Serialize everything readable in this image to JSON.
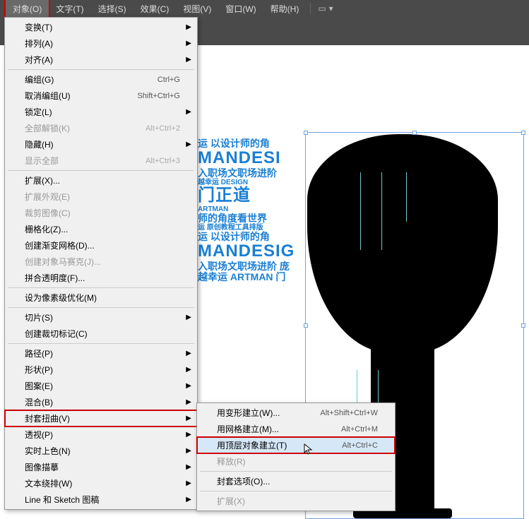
{
  "menubar": {
    "items": [
      "对象(O)",
      "文字(T)",
      "选择(S)",
      "效果(C)",
      "视图(V)",
      "窗口(W)",
      "帮助(H)"
    ]
  },
  "dropdown": [
    {
      "label": "变换(T)",
      "arrow": true
    },
    {
      "label": "排列(A)",
      "arrow": true
    },
    {
      "label": "对齐(A)",
      "arrow": true
    },
    {
      "sep": true
    },
    {
      "label": "编组(G)",
      "shortcut": "Ctrl+G"
    },
    {
      "label": "取消编组(U)",
      "shortcut": "Shift+Ctrl+G"
    },
    {
      "label": "锁定(L)",
      "arrow": true
    },
    {
      "label": "全部解锁(K)",
      "shortcut": "Alt+Ctrl+2",
      "disabled": true
    },
    {
      "label": "隐藏(H)",
      "arrow": true
    },
    {
      "label": "显示全部",
      "shortcut": "Alt+Ctrl+3",
      "disabled": true
    },
    {
      "sep": true
    },
    {
      "label": "扩展(X)..."
    },
    {
      "label": "扩展外观(E)",
      "disabled": true
    },
    {
      "label": "裁剪图像(C)",
      "disabled": true
    },
    {
      "label": "栅格化(Z)..."
    },
    {
      "label": "创建渐变网格(D)..."
    },
    {
      "label": "创建对象马赛克(J)...",
      "disabled": true
    },
    {
      "label": "拼合透明度(F)..."
    },
    {
      "sep": true
    },
    {
      "label": "设为像素级优化(M)"
    },
    {
      "sep": true
    },
    {
      "label": "切片(S)",
      "arrow": true
    },
    {
      "label": "创建裁切标记(C)"
    },
    {
      "sep": true
    },
    {
      "label": "路径(P)",
      "arrow": true
    },
    {
      "label": "形状(P)",
      "arrow": true
    },
    {
      "label": "图案(E)",
      "arrow": true
    },
    {
      "label": "混合(B)",
      "arrow": true
    },
    {
      "label": "封套扭曲(V)",
      "arrow": true,
      "highlighted": true
    },
    {
      "label": "透视(P)",
      "arrow": true
    },
    {
      "label": "实时上色(N)",
      "arrow": true
    },
    {
      "label": "图像描摹",
      "arrow": true
    },
    {
      "label": "文本绕排(W)",
      "arrow": true
    },
    {
      "label": "Line 和 Sketch 图稿",
      "arrow": true
    }
  ],
  "submenu": [
    {
      "label": "用变形建立(W)...",
      "shortcut": "Alt+Shift+Ctrl+W"
    },
    {
      "label": "用网格建立(M)...",
      "shortcut": "Alt+Ctrl+M"
    },
    {
      "label": "用顶层对象建立(T)",
      "shortcut": "Alt+Ctrl+C",
      "highlighted": true
    },
    {
      "label": "释放(R)",
      "disabled": true
    },
    {
      "sep": true
    },
    {
      "label": "封套选项(O)..."
    },
    {
      "sep": true
    },
    {
      "label": "扩展(X)",
      "disabled": true
    }
  ],
  "text_art": {
    "l1": "运 以设计师的角",
    "l2": "MANDESI",
    "l3": "入职场文职场进阶",
    "l4": "越幸运 DESIGN",
    "l5": "门正道",
    "l6": "ARTMAN",
    "l7": "师的角度看世界",
    "l8": "运 原创教程工具排版",
    "l9": "运 以设计师的角",
    "l10": "MANDESIG",
    "l11": "入职场文职场进阶 庞",
    "l12": "越幸运 ARTMAN 门"
  }
}
